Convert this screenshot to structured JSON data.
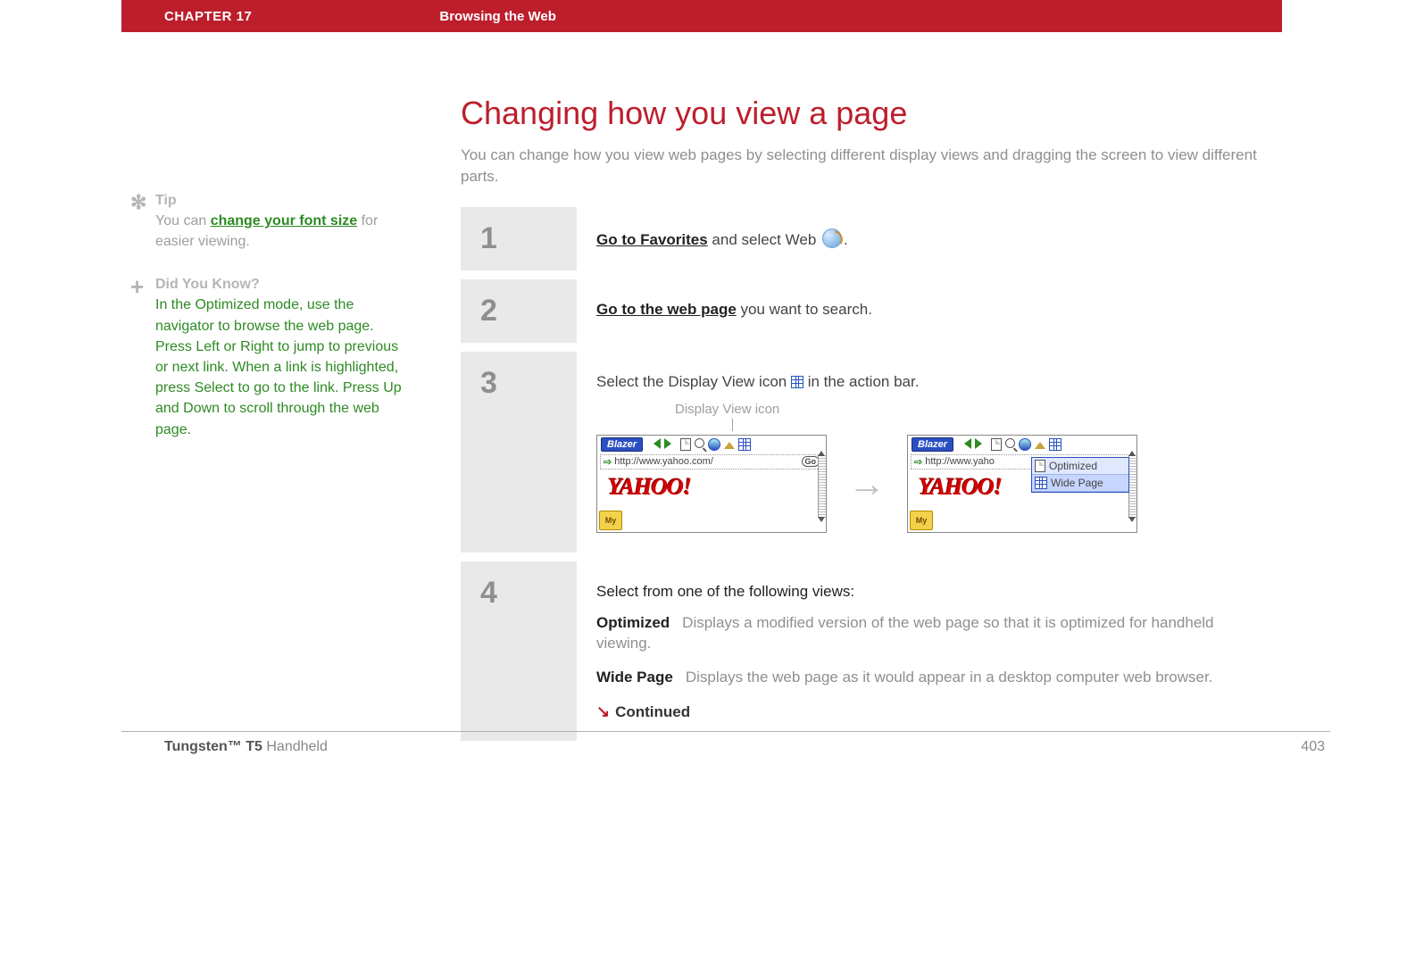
{
  "header": {
    "chapter": "CHAPTER 17",
    "title": "Browsing the Web"
  },
  "sidebar": {
    "tip": {
      "label": "Tip",
      "before": "You can ",
      "link": "change your font size",
      "after": " for easier viewing."
    },
    "dyk": {
      "label": "Did You Know?",
      "text": "In the Optimized mode, use the navigator to browse the web page. Press Left or Right to jump to previous or next link. When a link is highlighted, press Select to go to the link. Press Up and Down to scroll through the web page."
    }
  },
  "main": {
    "heading": "Changing how you view a page",
    "intro": "You can change how you view web pages by selecting different display views and dragging the screen to view different parts.",
    "steps": {
      "s1": {
        "num": "1",
        "link": "Go to Favorites",
        "after": " and select Web ",
        "dot": "."
      },
      "s2": {
        "num": "2",
        "link": "Go to the web page",
        "after": " you want to search."
      },
      "s3": {
        "num": "3",
        "before": "Select the Display View icon ",
        "after": " in the action bar.",
        "caption": "Display View icon",
        "shotA": {
          "app": "Blazer",
          "url": "http://www.yahoo.com/",
          "go": "Go",
          "logo": "YAHOO!",
          "my": "My"
        },
        "shotB": {
          "app": "Blazer",
          "url": "http://www.yaho",
          "logo": "YAHOO!",
          "my": "My",
          "menu": {
            "opt": "Optimized",
            "wide": "Wide Page"
          }
        }
      },
      "s4": {
        "num": "4",
        "intro": "Select from one of the following views:",
        "views": [
          {
            "name": "Optimized",
            "desc": "Displays a modified version of the web page so that it is optimized for handheld viewing."
          },
          {
            "name": "Wide Page",
            "desc": "Displays the web page as it would appear in a desktop computer web browser."
          }
        ],
        "continued": "Continued"
      }
    }
  },
  "footer": {
    "product_bold": "Tungsten™ T5",
    "product_rest": " Handheld",
    "page": "403"
  }
}
